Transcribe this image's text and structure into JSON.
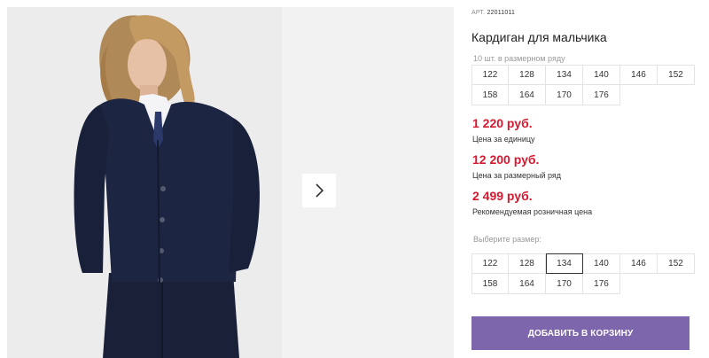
{
  "gallery": {
    "photo_alt": "Кардиган для мальчика",
    "next_icon": "chevron-right-icon"
  },
  "product": {
    "article_label": "АРТ.",
    "article_value": "22011011",
    "title": "Кардиган для мальчика",
    "pack_note": "10 шт. в размерном ряду",
    "pack_sizes": [
      "122",
      "128",
      "134",
      "140",
      "146",
      "152",
      "158",
      "164",
      "170",
      "176"
    ],
    "prices": [
      {
        "amount": "1 220 руб.",
        "caption": "Цена за единицу"
      },
      {
        "amount": "12 200 руб.",
        "caption": "Цена за размерный ряд"
      },
      {
        "amount": "2 499 руб.",
        "caption": "Рекомендуемая розничная цена"
      }
    ],
    "choose_label": "Выберите размер:",
    "select_sizes": [
      "122",
      "128",
      "134",
      "140",
      "146",
      "152",
      "158",
      "164",
      "170",
      "176"
    ],
    "selected_size": "134",
    "add_to_cart_label": "ДОБАВИТЬ В КОРЗИНУ"
  },
  "colors": {
    "accent": "#7e66ac",
    "price": "#d7192f",
    "cardigan": "#1c2541"
  }
}
